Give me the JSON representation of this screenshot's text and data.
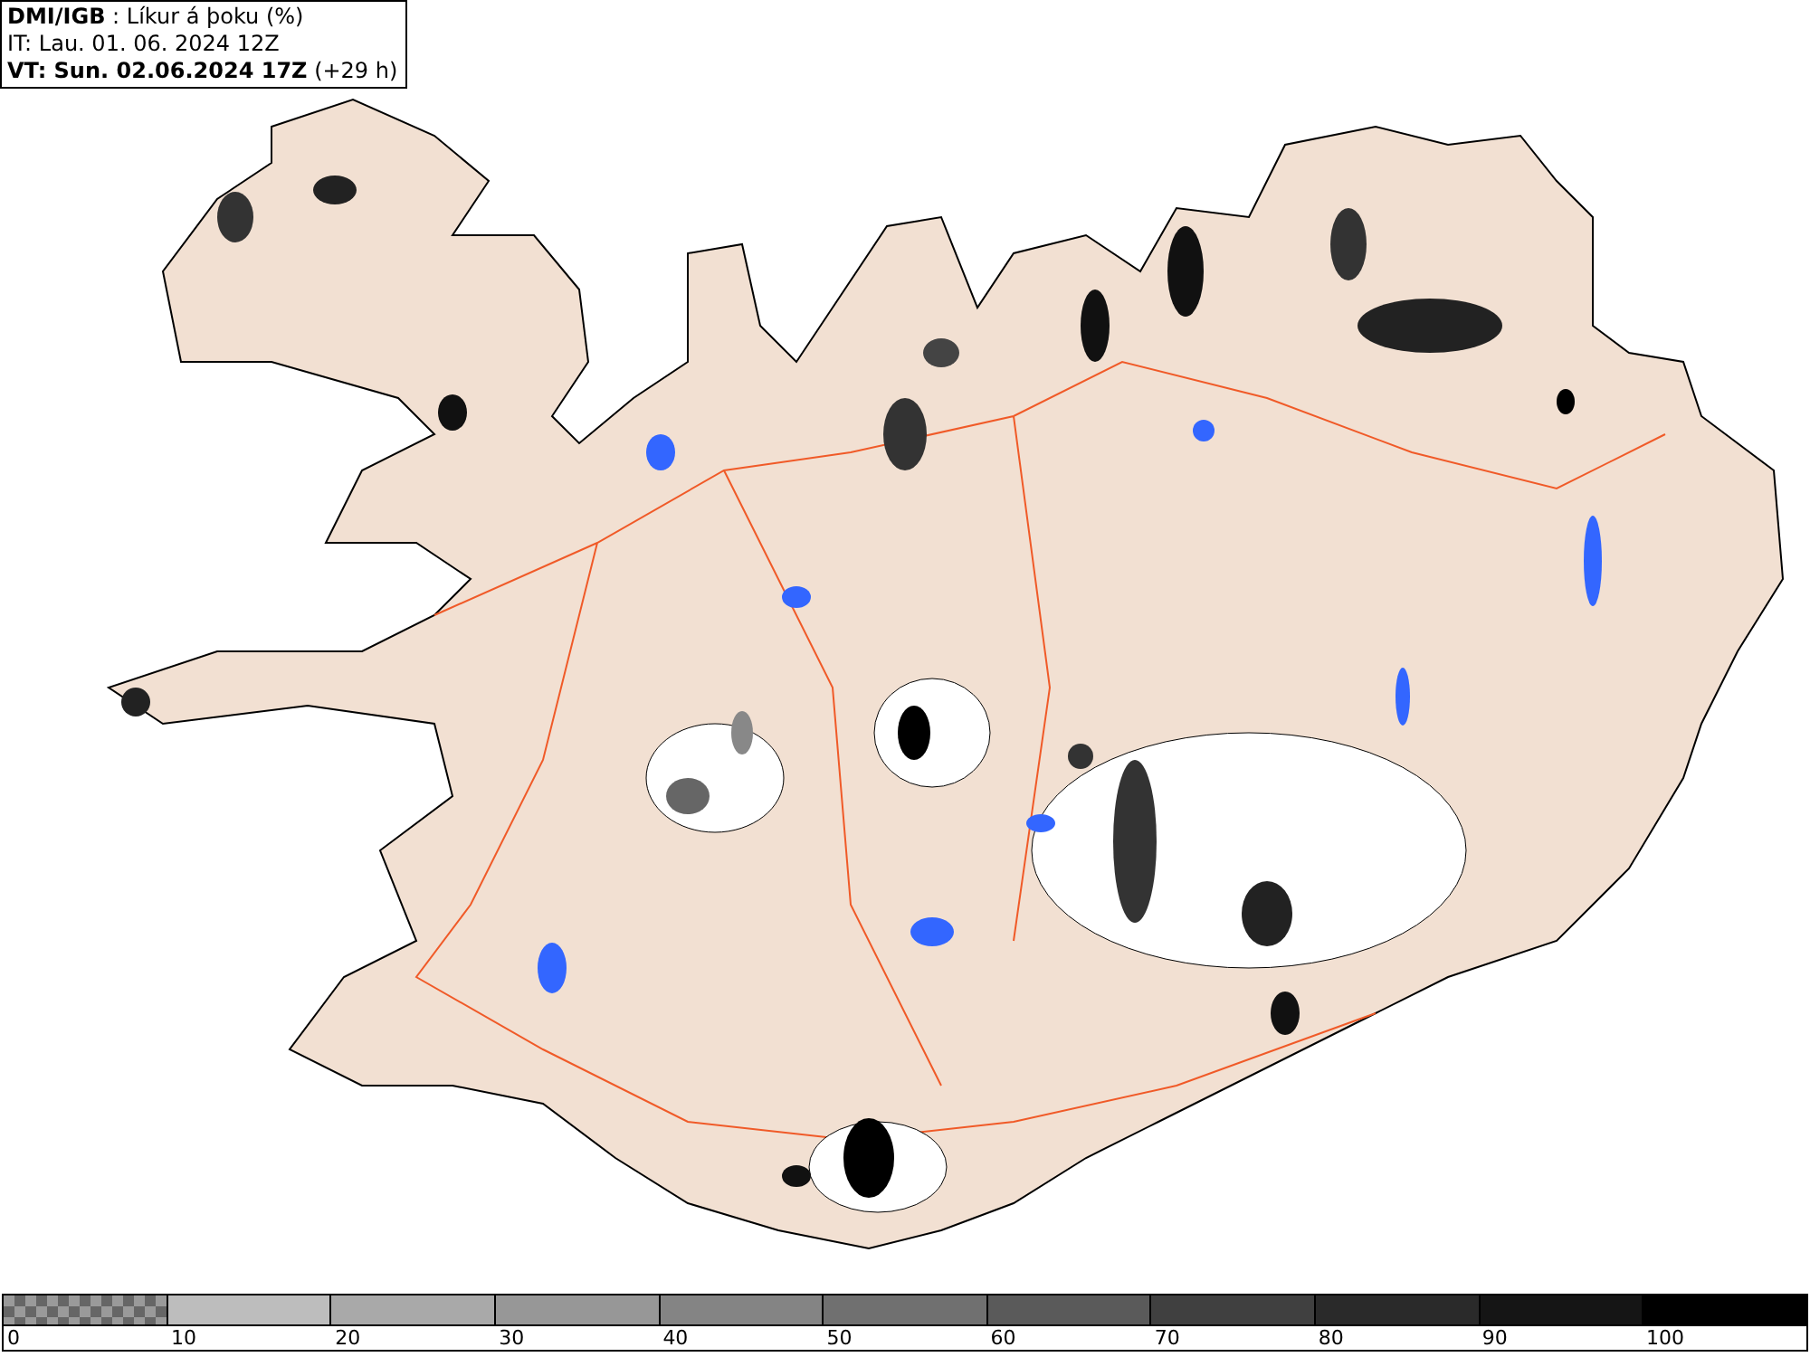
{
  "header": {
    "lines": [
      "**DMI/IGB** : Líkur á þoku (%)",
      "IT: Lau. 01. 06. 2024 12Z",
      "**VT: Sun. 02.06.2024 17Z** (+29 h)"
    ]
  },
  "legend": [
    {
      "kind": "checker",
      "color": "#9a9a9a",
      "label": "0"
    },
    {
      "kind": "solid",
      "color": "#bdbdbd",
      "label": "10"
    },
    {
      "kind": "solid",
      "color": "#a9a9a9",
      "label": "20"
    },
    {
      "kind": "solid",
      "color": "#979797",
      "label": "30"
    },
    {
      "kind": "solid",
      "color": "#848484",
      "label": "40"
    },
    {
      "kind": "solid",
      "color": "#707070",
      "label": "50"
    },
    {
      "kind": "solid",
      "color": "#5a5a5a",
      "label": "60"
    },
    {
      "kind": "solid",
      "color": "#404040",
      "label": "70"
    },
    {
      "kind": "solid",
      "color": "#2a2a2a",
      "label": "80"
    },
    {
      "kind": "solid",
      "color": "#151515",
      "label": "90"
    },
    {
      "kind": "solid",
      "color": "#000000",
      "label": "100"
    }
  ]
}
